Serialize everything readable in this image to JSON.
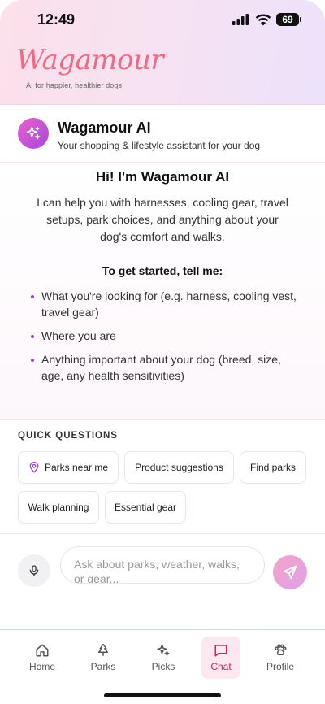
{
  "status": {
    "time": "12:49",
    "battery": "69"
  },
  "brand": {
    "logo": "Wagamour",
    "tagline": "AI for happier, healthier dogs"
  },
  "assistant": {
    "icon": "sparkles-icon",
    "title": "Wagamour AI",
    "subtitle": "Your shopping & lifestyle assistant for your dog"
  },
  "welcome": {
    "heading": "Hi! I'm Wagamour AI",
    "intro": "I can help you with harnesses, cooling gear, travel setups, park choices, and anything about your dog's comfort and walks.",
    "prompt": "To get started, tell me:",
    "bullets": [
      "What you're looking for (e.g. harness, cooling vest, travel gear)",
      "Where you are",
      "Anything important about your dog (breed, size, age, any health sensitivities)"
    ]
  },
  "quick": {
    "label": "QUICK QUESTIONS",
    "chips": [
      "Parks near me",
      "Product suggestions",
      "Find parks",
      "Walk planning",
      "Essential gear"
    ]
  },
  "input": {
    "placeholder": "Ask about parks, weather, walks, or gear..."
  },
  "nav": {
    "items": [
      {
        "label": "Home",
        "icon": "home-icon"
      },
      {
        "label": "Parks",
        "icon": "tree-icon"
      },
      {
        "label": "Picks",
        "icon": "sparkles-icon"
      },
      {
        "label": "Chat",
        "icon": "chat-icon",
        "active": true
      },
      {
        "label": "Profile",
        "icon": "paw-icon"
      }
    ]
  },
  "colors": {
    "accent": "#d81b60",
    "brand": "#ee6b84",
    "bullet": "#9c3fd8"
  }
}
